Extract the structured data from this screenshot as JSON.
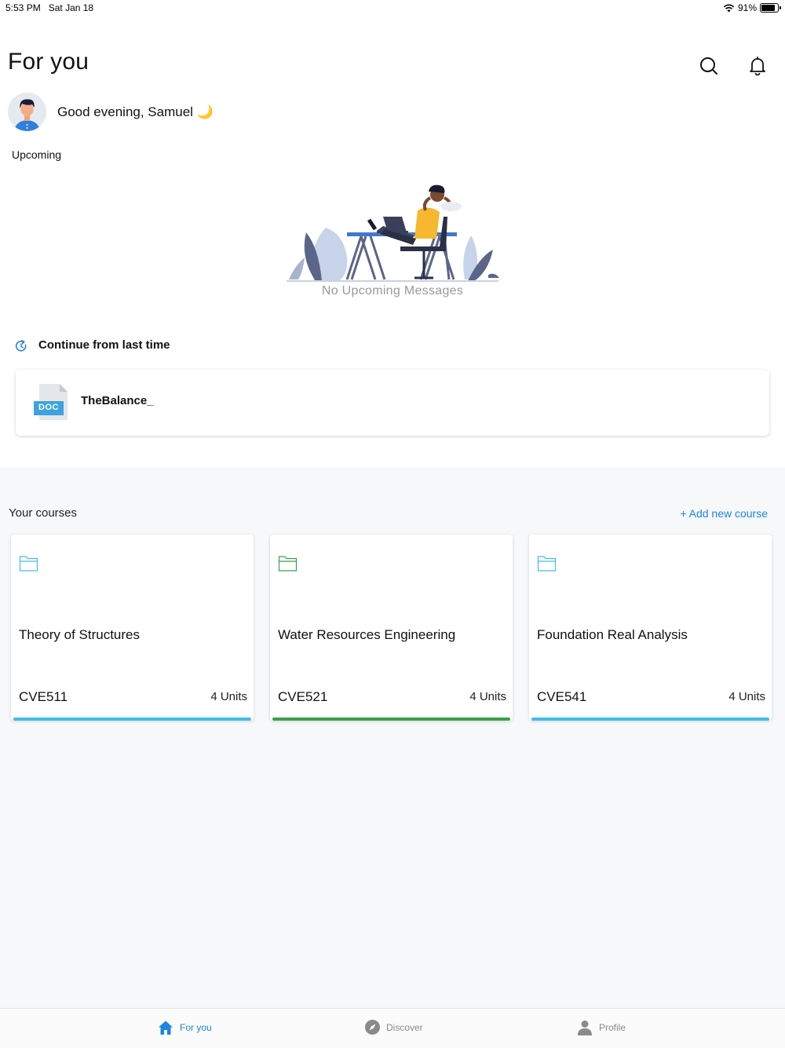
{
  "status_bar": {
    "time": "5:53 PM",
    "date": "Sat Jan 18",
    "battery": "91%"
  },
  "header": {
    "title": "For you"
  },
  "greeting": {
    "text": "Good evening, Samuel",
    "emoji": "🌙"
  },
  "upcoming": {
    "label": "Upcoming",
    "empty_message": "No Upcoming Messages"
  },
  "continue": {
    "title": "Continue from last time",
    "item": {
      "badge": "DOC",
      "name": "TheBalance_"
    }
  },
  "courses": {
    "label": "Your courses",
    "add_label": "+ Add new course",
    "items": [
      {
        "name": "Theory of Structures",
        "code": "CVE511",
        "units": "4 Units",
        "color": "#43bde8"
      },
      {
        "name": "Water Resources Engineering",
        "code": "CVE521",
        "units": "4 Units",
        "color": "#3aa14a"
      },
      {
        "name": "Foundation Real Analysis",
        "code": "CVE541",
        "units": "4 Units",
        "color": "#43bde8"
      }
    ]
  },
  "nav": {
    "items": [
      {
        "label": "For you",
        "icon": "home-icon",
        "active": true
      },
      {
        "label": "Discover",
        "icon": "compass-icon",
        "active": false
      },
      {
        "label": "Profile",
        "icon": "person-icon",
        "active": false
      }
    ]
  },
  "colors": {
    "accent": "#1b86e0",
    "course_blue": "#43bde8",
    "course_green": "#3aa14a"
  }
}
